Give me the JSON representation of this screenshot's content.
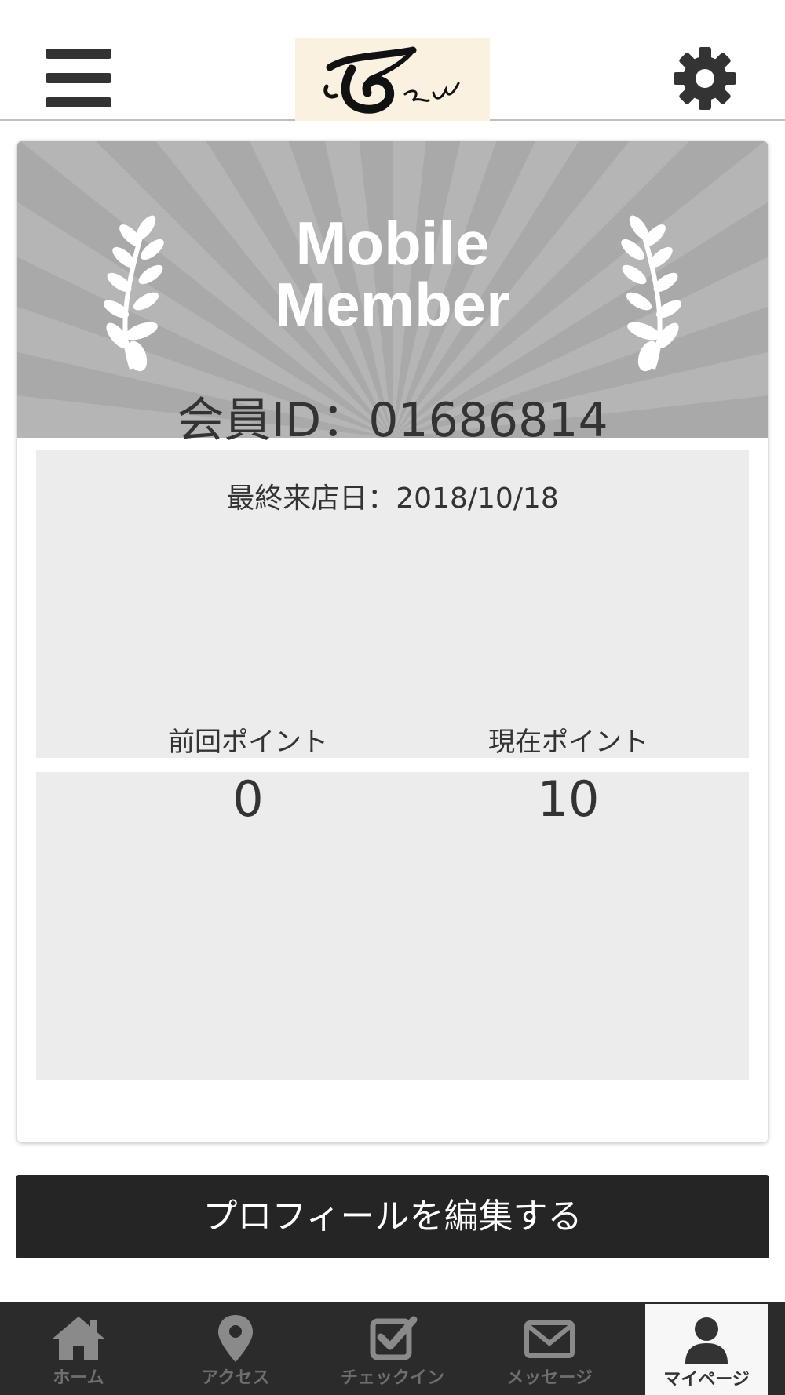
{
  "header": {
    "logo_text": "む えん"
  },
  "banner": {
    "line1": "Mobile",
    "line2": "Member"
  },
  "member": {
    "id_text": "会員ID：01686814",
    "last_visit_text": "最終来店日：2018/10/18"
  },
  "points": {
    "previous_label": "前回ポイント",
    "previous_value": "0",
    "current_label": "現在ポイント",
    "current_value": "10"
  },
  "edit_profile_label": "プロフィールを編集する",
  "nav": {
    "items": [
      {
        "label": "ホーム",
        "icon": "home-icon"
      },
      {
        "label": "アクセス",
        "icon": "map-pin-icon"
      },
      {
        "label": "チェックイン",
        "icon": "checkbox-icon"
      },
      {
        "label": "メッセージ",
        "icon": "envelope-icon"
      },
      {
        "label": "マイページ",
        "icon": "user-icon",
        "active": true
      }
    ]
  },
  "colors": {
    "banner_bg": "#a9a9a9",
    "panel_bg": "#ececec",
    "button_bg": "#252525",
    "nav_bg": "#2b2b2b"
  }
}
